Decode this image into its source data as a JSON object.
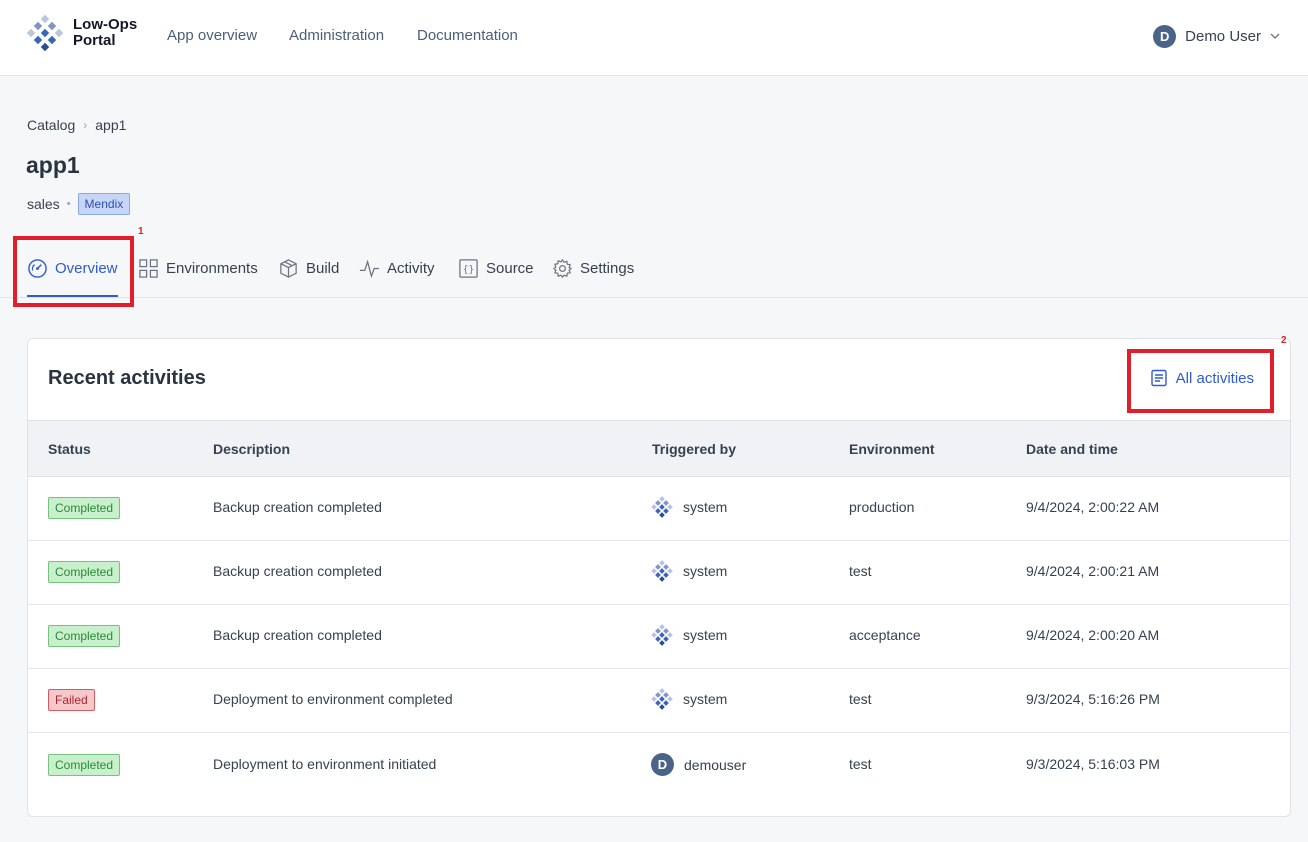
{
  "app": {
    "brand": "Low-Ops Portal",
    "brand_line1": "Low-Ops",
    "brand_line2": "Portal"
  },
  "nav": {
    "items": [
      {
        "label": "App overview"
      },
      {
        "label": "Administration"
      },
      {
        "label": "Documentation"
      }
    ],
    "user": {
      "initial": "D",
      "name": "Demo User"
    }
  },
  "breadcrumb": {
    "items": [
      "Catalog",
      "app1"
    ],
    "separator": "›"
  },
  "page": {
    "title": "app1",
    "team": "sales",
    "separator": "•",
    "tech_badge": "Mendix"
  },
  "tabs": [
    {
      "label": "Overview",
      "icon": "dashboard-gauge-icon",
      "active": true
    },
    {
      "label": "Environments",
      "icon": "grid-icon",
      "active": false
    },
    {
      "label": "Build",
      "icon": "package-box-icon",
      "active": false
    },
    {
      "label": "Activity",
      "icon": "activity-pulse-icon",
      "active": false
    },
    {
      "label": "Source",
      "icon": "code-braces-icon",
      "active": false
    },
    {
      "label": "Settings",
      "icon": "gear-icon",
      "active": false
    }
  ],
  "annotations": [
    {
      "number": "1"
    },
    {
      "number": "2"
    }
  ],
  "activities": {
    "title": "Recent activities",
    "all_link": "All activities",
    "all_link_icon": "document-list-icon",
    "columns": [
      "Status",
      "Description",
      "Triggered by",
      "Environment",
      "Date and time"
    ],
    "rows": [
      {
        "status": "Completed",
        "description": "Backup creation completed",
        "triggered_by": "system",
        "trigger_icon": "system-logo-icon",
        "environment": "production",
        "datetime": "9/4/2024, 2:00:22 AM"
      },
      {
        "status": "Completed",
        "description": "Backup creation completed",
        "triggered_by": "system",
        "trigger_icon": "system-logo-icon",
        "environment": "test",
        "datetime": "9/4/2024, 2:00:21 AM"
      },
      {
        "status": "Completed",
        "description": "Backup creation completed",
        "triggered_by": "system",
        "trigger_icon": "system-logo-icon",
        "environment": "acceptance",
        "datetime": "9/4/2024, 2:00:20 AM"
      },
      {
        "status": "Failed",
        "description": "Deployment to environment completed",
        "triggered_by": "system",
        "trigger_icon": "system-logo-icon",
        "environment": "test",
        "datetime": "9/3/2024, 5:16:26 PM"
      },
      {
        "status": "Completed",
        "description": "Deployment to environment initiated",
        "triggered_by": "demouser",
        "trigger_initial": "D",
        "environment": "test",
        "datetime": "9/3/2024, 5:16:03 PM"
      }
    ]
  },
  "colors": {
    "accent": "#2f5bd3",
    "callout": "#e01f2a",
    "completed_bg": "#c9f0cd",
    "failed_bg": "#f5c9cc",
    "badge_bg": "#c7d6f7"
  }
}
